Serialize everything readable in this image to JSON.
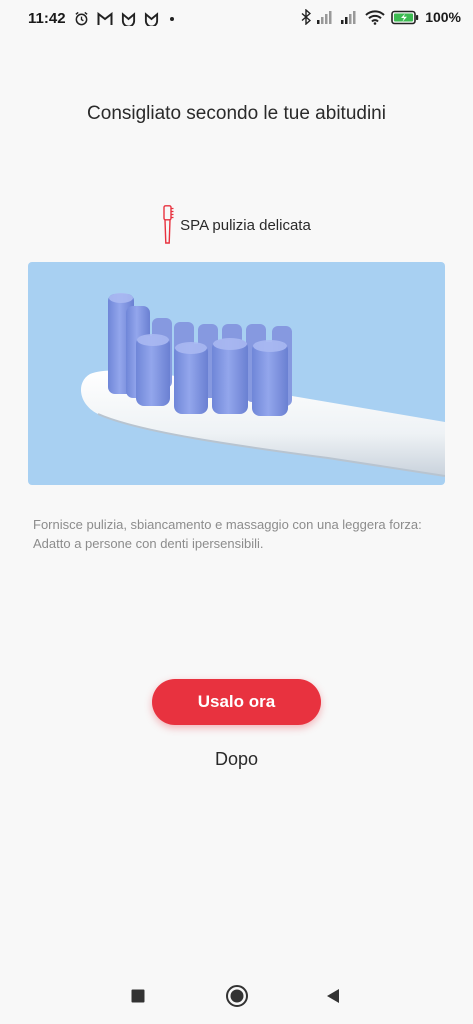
{
  "status_bar": {
    "time": "11:42",
    "battery": "100%",
    "icons": [
      "alarm-icon",
      "gmail-icon",
      "mi-app-icon",
      "mi-app-icon",
      "dot-icon",
      "bluetooth-icon",
      "signal-icon",
      "signal-icon",
      "wifi-icon",
      "battery-charging-icon"
    ]
  },
  "screen": {
    "heading": "Consigliato secondo le tue abitudini",
    "mode": {
      "icon": "toothbrush-head-icon",
      "label": "SPA pulizia delicata"
    },
    "description": "Fornisce pulizia, sbiancamento e massaggio con una leggera forza: Adatto a persone con denti ipersensibili.",
    "primary_button": "Usalo ora",
    "secondary_button": "Dopo"
  },
  "nav_bar": {
    "icons": [
      "recents-square-icon",
      "home-circle-icon",
      "back-triangle-icon"
    ]
  },
  "colors": {
    "accent": "#e8323f",
    "hero_bg": "#a8d0f2",
    "bristles": "#7b92e0"
  }
}
